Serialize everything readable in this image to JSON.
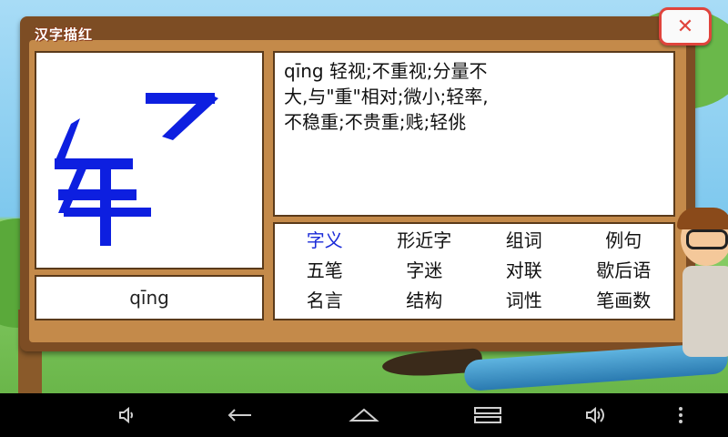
{
  "app": {
    "title": "汉字描红",
    "close_symbol": "✕"
  },
  "character": {
    "glyph": "轻",
    "pinyin": "qīng"
  },
  "definition": "qīng 轻视;不重视;分量不大,与\"重\"相对;微小;轻率,不稳重;不贵重;贱;轻佻",
  "menu": {
    "items": [
      {
        "label": "字义",
        "active": true
      },
      {
        "label": "形近字"
      },
      {
        "label": "组词"
      },
      {
        "label": "例句"
      },
      {
        "label": "五笔"
      },
      {
        "label": "字迷"
      },
      {
        "label": "对联"
      },
      {
        "label": "歇后语"
      },
      {
        "label": "名言"
      },
      {
        "label": "结构"
      },
      {
        "label": "词性"
      },
      {
        "label": "笔画数"
      }
    ]
  },
  "navbar": {
    "buttons": [
      "volume-down-icon",
      "back-icon",
      "home-icon",
      "recent-apps-icon",
      "volume-up-icon",
      "overflow-menu-icon"
    ]
  },
  "colors": {
    "active_menu": "#1a2ad8",
    "stroke": "#0d1fe0",
    "board": "#7d4d24",
    "close": "#e0443c"
  }
}
